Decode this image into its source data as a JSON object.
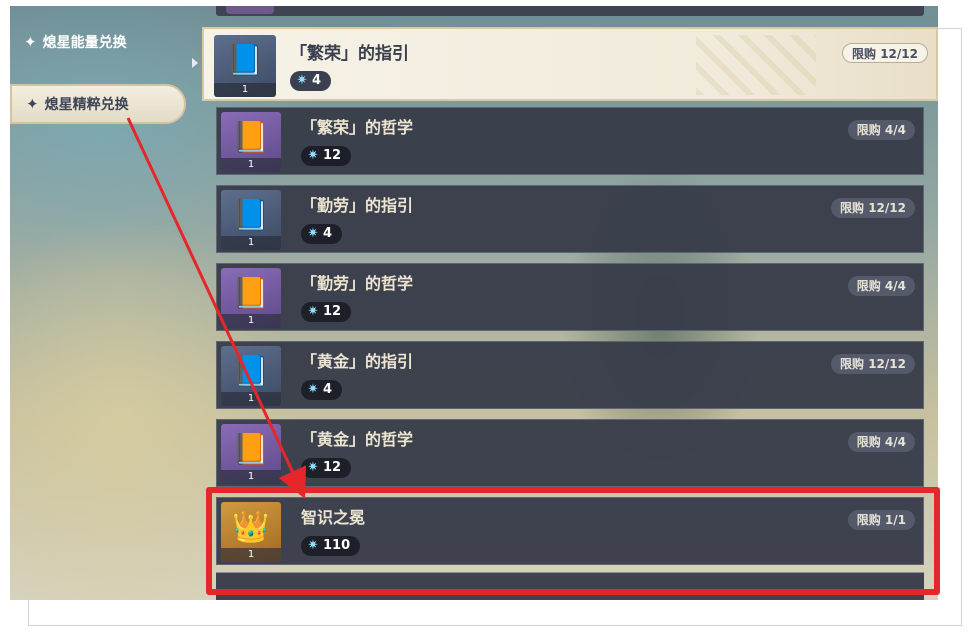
{
  "sidebar": {
    "tabs": [
      {
        "label": "熄星能量兑换",
        "icon": "four-point-star-icon"
      },
      {
        "label": "熄星精粹兑换",
        "icon": "four-point-star-icon"
      }
    ]
  },
  "shop": {
    "items": [
      {
        "title": "「繁荣」的指引",
        "cost": "4",
        "limit": "限购 12/12",
        "quantity": "1",
        "icon": "book-guide-icon"
      },
      {
        "title": "「繁荣」的哲学",
        "cost": "12",
        "limit": "限购 4/4",
        "quantity": "1",
        "icon": "book-philosophy-icon"
      },
      {
        "title": "「勤劳」的指引",
        "cost": "4",
        "limit": "限购 12/12",
        "quantity": "1",
        "icon": "book-guide-icon"
      },
      {
        "title": "「勤劳」的哲学",
        "cost": "12",
        "limit": "限购 4/4",
        "quantity": "1",
        "icon": "book-philosophy-icon"
      },
      {
        "title": "「黄金」的指引",
        "cost": "4",
        "limit": "限购 12/12",
        "quantity": "1",
        "icon": "book-guide-icon"
      },
      {
        "title": "「黄金」的哲学",
        "cost": "12",
        "limit": "限购 4/4",
        "quantity": "1",
        "icon": "book-philosophy-icon"
      },
      {
        "title": "智识之冕",
        "cost": "110",
        "limit": "限购 1/1",
        "quantity": "1",
        "icon": "crown-icon"
      }
    ]
  },
  "colors": {
    "highlight": "#e5262a",
    "selected_bg": "#f1ebdc",
    "item_bg": "#383c4a"
  }
}
